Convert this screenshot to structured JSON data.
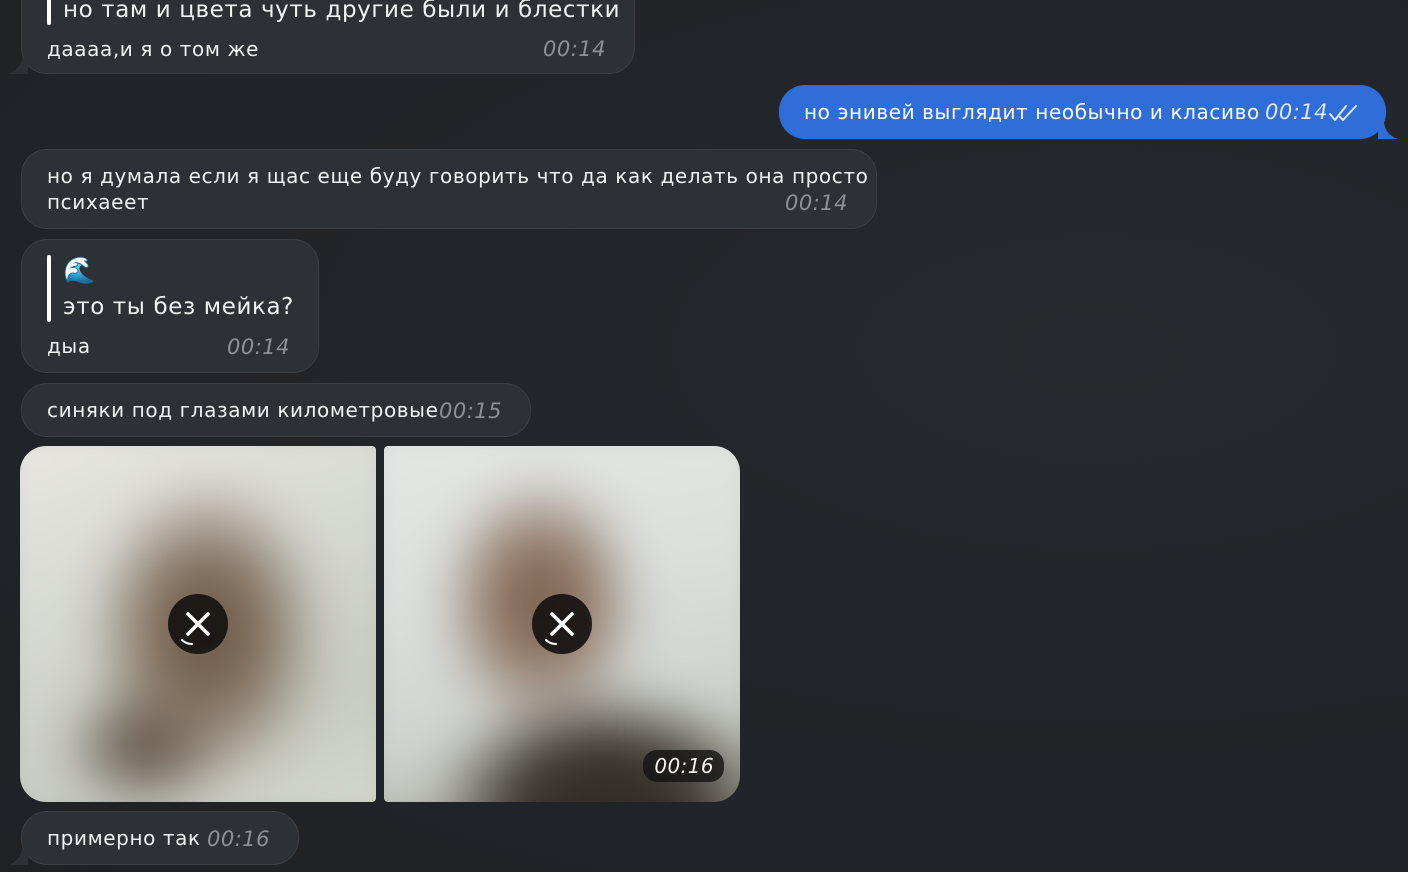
{
  "messages": {
    "m1": {
      "quote": "но там и цвета чуть другие были и блестки",
      "text": "даааа,и я о том же",
      "time": "00:14"
    },
    "m2": {
      "text": "но энивей выглядит необычно и класиво",
      "time": "00:14",
      "status_icon": "double-check-icon"
    },
    "m3": {
      "text_line1": "но я думала если я щас еще буду говорить что да как делать она просто",
      "text_line2": "психаеет",
      "time": "00:14"
    },
    "m4": {
      "quote_emoji": "🌊",
      "quote": "это ты без мейка?",
      "text": "дыа",
      "time": "00:14"
    },
    "m5": {
      "text": "синяки под глазами километровые",
      "time": "00:15"
    },
    "photos": {
      "time": "00:16",
      "cancel_icon": "close-icon"
    },
    "m7": {
      "text": "примерно так",
      "time": "00:16"
    }
  },
  "colors": {
    "background": "#212428",
    "incoming_bubble": "#2d3034",
    "outgoing_bubble": "#2f6ed8",
    "timestamp": "#8d9196"
  }
}
